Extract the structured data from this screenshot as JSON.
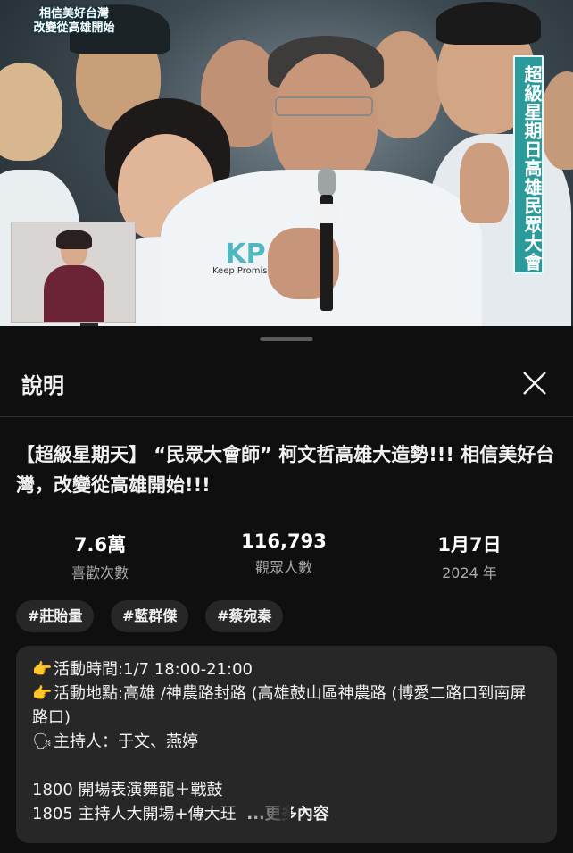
{
  "video": {
    "overlay_title_line1": "相信美好台灣",
    "overlay_title_line2": "改變從高雄開始",
    "side_banner": "超級星期日高雄民眾大會",
    "jacket_brand": "Keep Promise",
    "jacket_logo": "KP"
  },
  "sheet": {
    "title": "說明",
    "close_icon": "close-x-icon"
  },
  "video_title": "【超級星期天】 “民眾大會師” 柯文哲高雄大造勢!!! 相信美好台灣，改變從高雄開始!!!",
  "stats": [
    {
      "value": "7.6萬",
      "label": "喜歡次數"
    },
    {
      "value": "116,793",
      "label": "觀眾人數"
    },
    {
      "value": "1月7日",
      "label": "2024 年"
    }
  ],
  "hashtags": [
    "#莊貽量",
    "#藍群傑",
    "#蔡宛秦"
  ],
  "description": {
    "line1_icon": "👉",
    "line1": "活動時間:1/7 18:00-21:00",
    "line2_icon": "👉",
    "line2": "活動地點:高雄 /神農路封路 (高雄鼓山區神農路 (博愛二路口到南屏路口)",
    "line3_icon": "🗣",
    "line3": "主持人：于文、燕婷",
    "line4": "1800 開場表演舞龍＋戰鼓",
    "line5": "1805 主持人大開場+傳大玨",
    "more_label": "...更多內容"
  }
}
